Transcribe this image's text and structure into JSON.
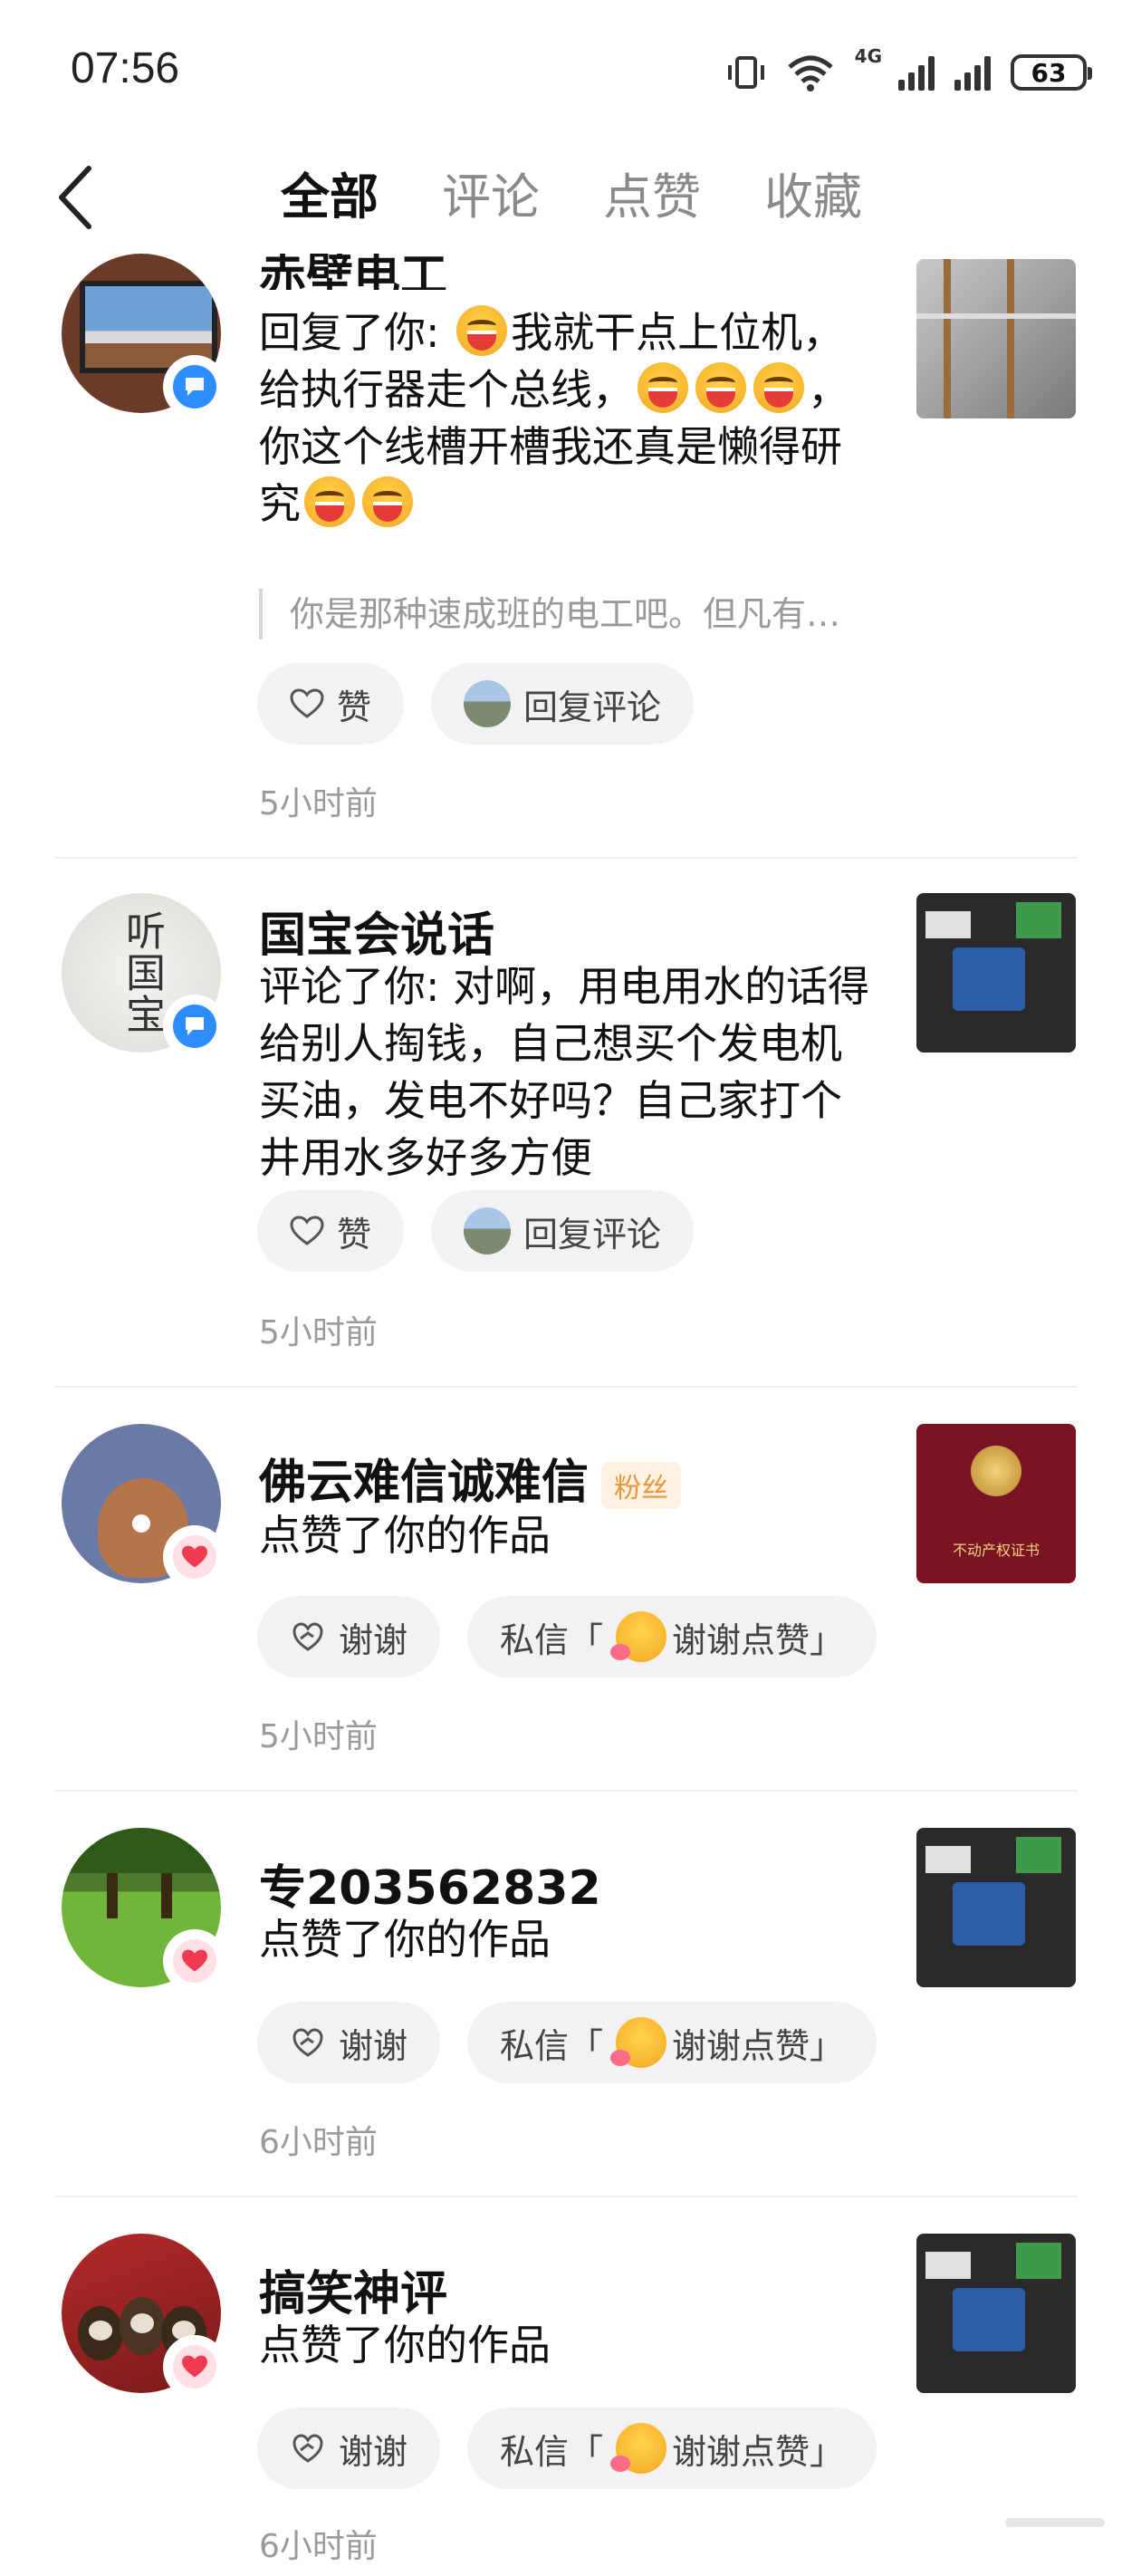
{
  "status_bar": {
    "time": "07:56",
    "battery": "63",
    "network": "4G"
  },
  "header": {
    "tabs": [
      {
        "label": "全部",
        "active": true
      },
      {
        "label": "评论",
        "active": false
      },
      {
        "label": "点赞",
        "active": false
      },
      {
        "label": "收藏",
        "active": false
      }
    ]
  },
  "items": [
    {
      "type": "comment",
      "name": "赤壁电工",
      "text_parts": [
        "回复了你: ",
        "我就干点上位机，给执行器走个总线，",
        "，你这个线槽开槽我还真是懒得研究"
      ],
      "quote": "你是那种速成班的电工吧。但凡有…",
      "like_label": "赞",
      "reply_label": "回复评论",
      "time": "5小时前"
    },
    {
      "type": "comment",
      "name": "国宝会说话",
      "text": "评论了你: 对啊，用电用水的话得给别人掏钱，自己想买个发电机买油，发电不好吗？自己家打个井用水多好多方便",
      "avatar_text": "听国宝",
      "like_label": "赞",
      "reply_label": "回复评论",
      "time": "5小时前"
    },
    {
      "type": "like",
      "name": "佛云难信诚难信",
      "tag": "粉丝",
      "text": "点赞了你的作品",
      "thanks_label": "谢谢",
      "dm_prefix": "私信「",
      "dm_text": "谢谢点赞」",
      "time": "5小时前",
      "thumb_text": "不动产权证书"
    },
    {
      "type": "like",
      "name": "专203562832",
      "text": "点赞了你的作品",
      "thanks_label": "谢谢",
      "dm_prefix": "私信「",
      "dm_text": "谢谢点赞」",
      "time": "6小时前"
    },
    {
      "type": "like",
      "name": "搞笑神评",
      "text": "点赞了你的作品",
      "thanks_label": "谢谢",
      "dm_prefix": "私信「",
      "dm_text": "谢谢点赞」",
      "time": "6小时前"
    }
  ]
}
